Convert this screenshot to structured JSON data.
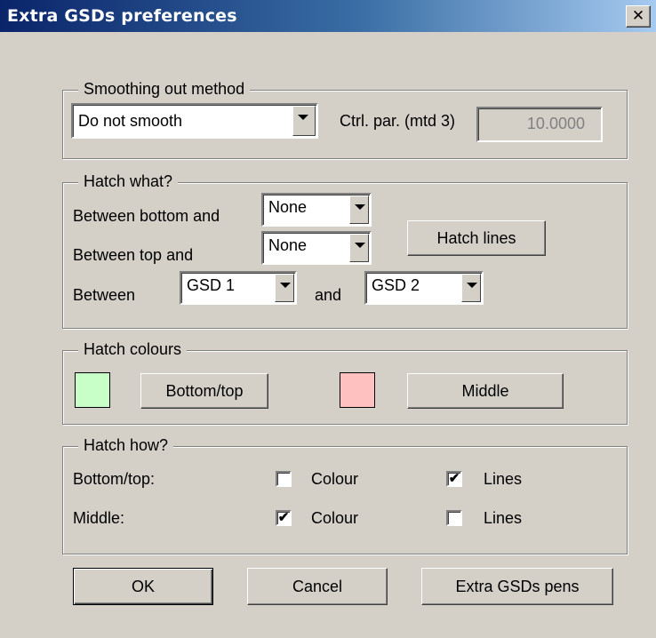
{
  "window": {
    "title": "Extra GSDs preferences",
    "close_glyph": "✕"
  },
  "smoothing": {
    "legend": "Smoothing out method",
    "method_value": "Do not smooth",
    "ctrl_label": "Ctrl. par. (mtd 3)",
    "ctrl_value": "10.0000"
  },
  "hatch_what": {
    "legend": "Hatch what?",
    "bottom_label": "Between bottom and",
    "bottom_value": "None",
    "top_label": "Between top and",
    "top_value": "None",
    "between_label": "Between",
    "between_from": "GSD 1",
    "and_label": "and",
    "between_to": "GSD 2",
    "hatch_lines_button": "Hatch lines"
  },
  "hatch_colours": {
    "legend": "Hatch colours",
    "bottom_top_color": "#c8ffc8",
    "bottom_top_button": "Bottom/top",
    "middle_color": "#ffc0c0",
    "middle_button": "Middle"
  },
  "hatch_how": {
    "legend": "Hatch how?",
    "rows": [
      {
        "label": "Bottom/top:",
        "colour_label": "Colour",
        "colour_checked": false,
        "lines_label": "Lines",
        "lines_checked": true
      },
      {
        "label": "Middle:",
        "colour_label": "Colour",
        "colour_checked": true,
        "lines_label": "Lines",
        "lines_checked": false
      }
    ]
  },
  "buttons": {
    "ok": "OK",
    "cancel": "Cancel",
    "pens": "Extra GSDs pens"
  }
}
